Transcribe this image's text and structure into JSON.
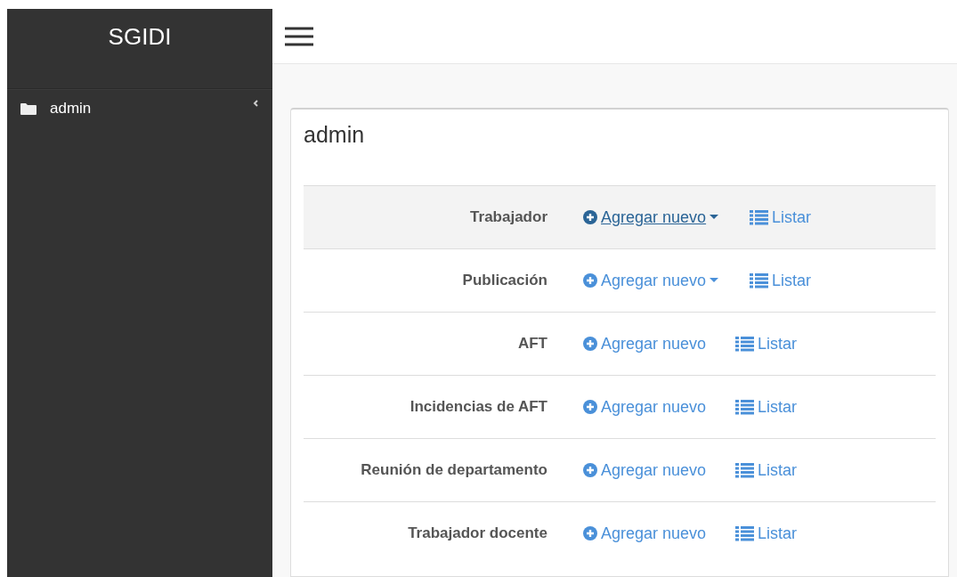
{
  "sidebar": {
    "brand": "SGIDI",
    "items": [
      {
        "label": "admin",
        "expanded": false
      }
    ]
  },
  "card": {
    "title": "admin",
    "rows": [
      {
        "label": "Trabajador",
        "hovered": true,
        "add": "Agregar nuevo",
        "has_dropdown": true,
        "list": "Listar"
      },
      {
        "label": "Publicación",
        "hovered": false,
        "add": "Agregar nuevo",
        "has_dropdown": true,
        "list": "Listar"
      },
      {
        "label": "AFT",
        "hovered": false,
        "add": "Agregar nuevo",
        "has_dropdown": false,
        "list": "Listar"
      },
      {
        "label": "Incidencias de AFT",
        "hovered": false,
        "add": "Agregar nuevo",
        "has_dropdown": false,
        "list": "Listar"
      },
      {
        "label": "Reunión de departamento",
        "hovered": false,
        "add": "Agregar nuevo",
        "has_dropdown": false,
        "list": "Listar"
      },
      {
        "label": "Trabajador docente",
        "hovered": false,
        "add": "Agregar nuevo",
        "has_dropdown": false,
        "list": "Listar"
      }
    ]
  }
}
